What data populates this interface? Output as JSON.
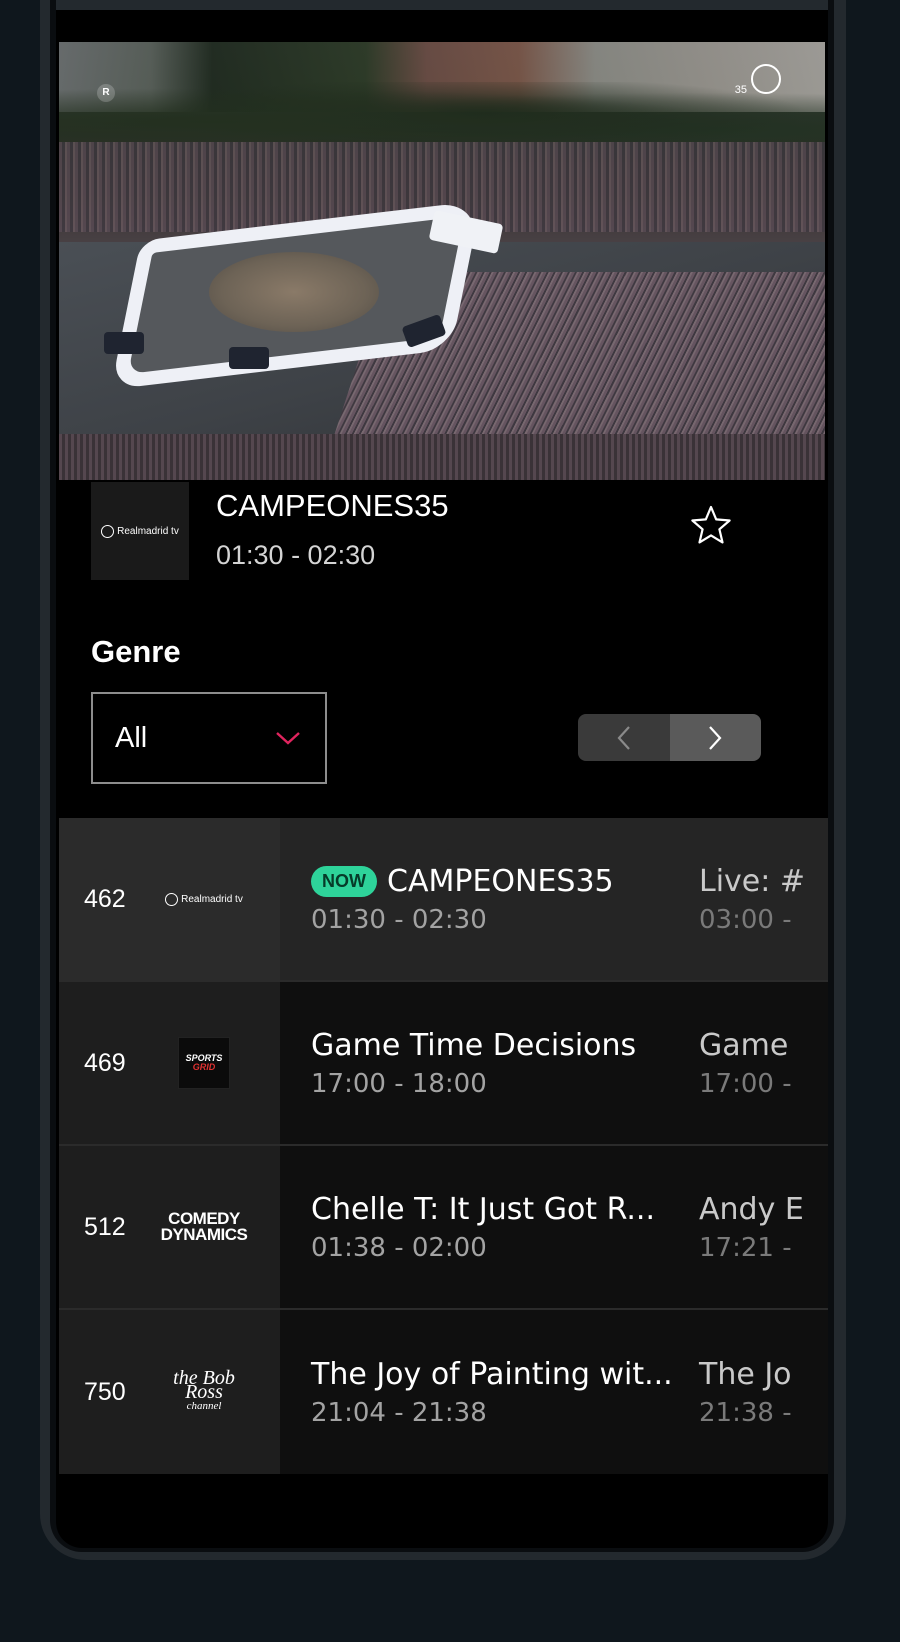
{
  "video": {
    "badge_left": "R",
    "badge_right_num": "35"
  },
  "now_playing": {
    "channel_logo": "Realmadrid tv",
    "title": "CAMPEONES35",
    "time": "01:30 - 02:30",
    "favorite_icon": "star-outline-icon"
  },
  "genre": {
    "label": "Genre",
    "selected": "All"
  },
  "pager": {
    "prev_icon": "chevron-left-icon",
    "next_icon": "chevron-right-icon"
  },
  "colors": {
    "now_badge": "#2ed39a",
    "dropdown_chevron": "#e0245e",
    "background": "#000000"
  },
  "guide": {
    "rows": [
      {
        "number": "462",
        "logo": "Realmadrid tv",
        "now_badge": "NOW",
        "program1": {
          "title": "CAMPEONES35",
          "time": "01:30 - 02:30"
        },
        "program2": {
          "title": "Live: #",
          "time": "03:00 -"
        }
      },
      {
        "number": "469",
        "logo_top": "SPORTS",
        "logo_bottom": "GRID",
        "program1": {
          "title": "Game Time Decisions",
          "time": "17:00 - 18:00"
        },
        "program2": {
          "title": "Game",
          "time": "17:00 -"
        }
      },
      {
        "number": "512",
        "logo_top": "COMEDY",
        "logo_bottom": "DYNAMICS",
        "program1": {
          "title": "Chelle T: It Just Got R...",
          "time": "01:38 - 02:00"
        },
        "program2": {
          "title": "Andy E",
          "time": "17:21 -"
        }
      },
      {
        "number": "750",
        "logo_top": "the Bob Ross",
        "logo_bottom": "channel",
        "program1": {
          "title": "The Joy of Painting wit...",
          "time": "21:04 - 21:38"
        },
        "program2": {
          "title": "The Jo",
          "time": "21:38 -"
        }
      }
    ]
  }
}
